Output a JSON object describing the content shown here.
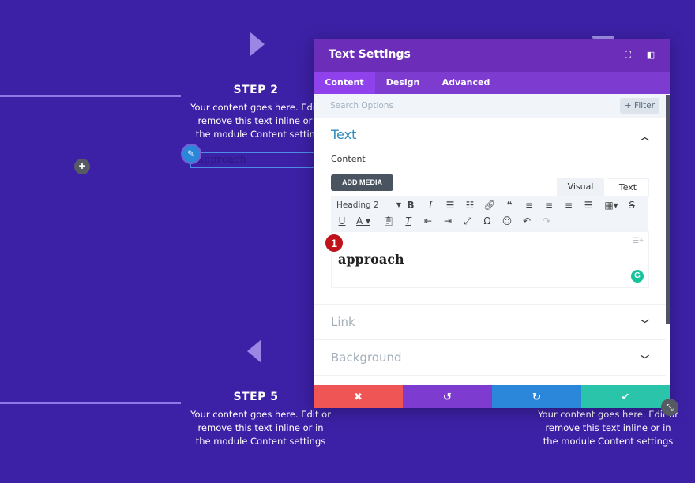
{
  "page": {
    "steps": [
      {
        "title": "STEP 2",
        "body": "Your content goes here. Edit or remove this text inline or in the module Content settings"
      },
      {
        "title": "STEP 5",
        "body": "Your content goes here. Edit or remove this text inline or in the module Content settings"
      },
      {
        "title": "",
        "body": "Your content goes here. Edit or remove this text inline or in the module Content settings"
      }
    ],
    "inline_text": "approach",
    "add_icon": "+"
  },
  "modal": {
    "title": "Text Settings",
    "header_icons": [
      "fullscreen-icon",
      "split-view-icon"
    ],
    "tabs": [
      {
        "label": "Content",
        "active": true
      },
      {
        "label": "Design",
        "active": false
      },
      {
        "label": "Advanced",
        "active": false
      }
    ],
    "search_placeholder": "Search Options",
    "filter_label": "+ Filter",
    "sections": {
      "text": {
        "title": "Text",
        "content_label": "Content",
        "add_media_label": "ADD MEDIA",
        "mode_tabs": [
          "Visual",
          "Text"
        ],
        "format_select": "Heading 2",
        "editor_value": "approach",
        "badge_number": "1"
      },
      "link": {
        "title": "Link"
      },
      "background": {
        "title": "Background"
      }
    },
    "footer": {
      "cancel_icon": "✖",
      "undo_icon": "↺",
      "redo_icon": "↻",
      "save_icon": "✔"
    },
    "colors": {
      "cancel": "#ef5555",
      "undo": "#7d3bcf",
      "redo": "#2b87da",
      "save": "#29c4a9",
      "header": "#6c2eb9",
      "tabs": "#7e3bd0"
    }
  }
}
